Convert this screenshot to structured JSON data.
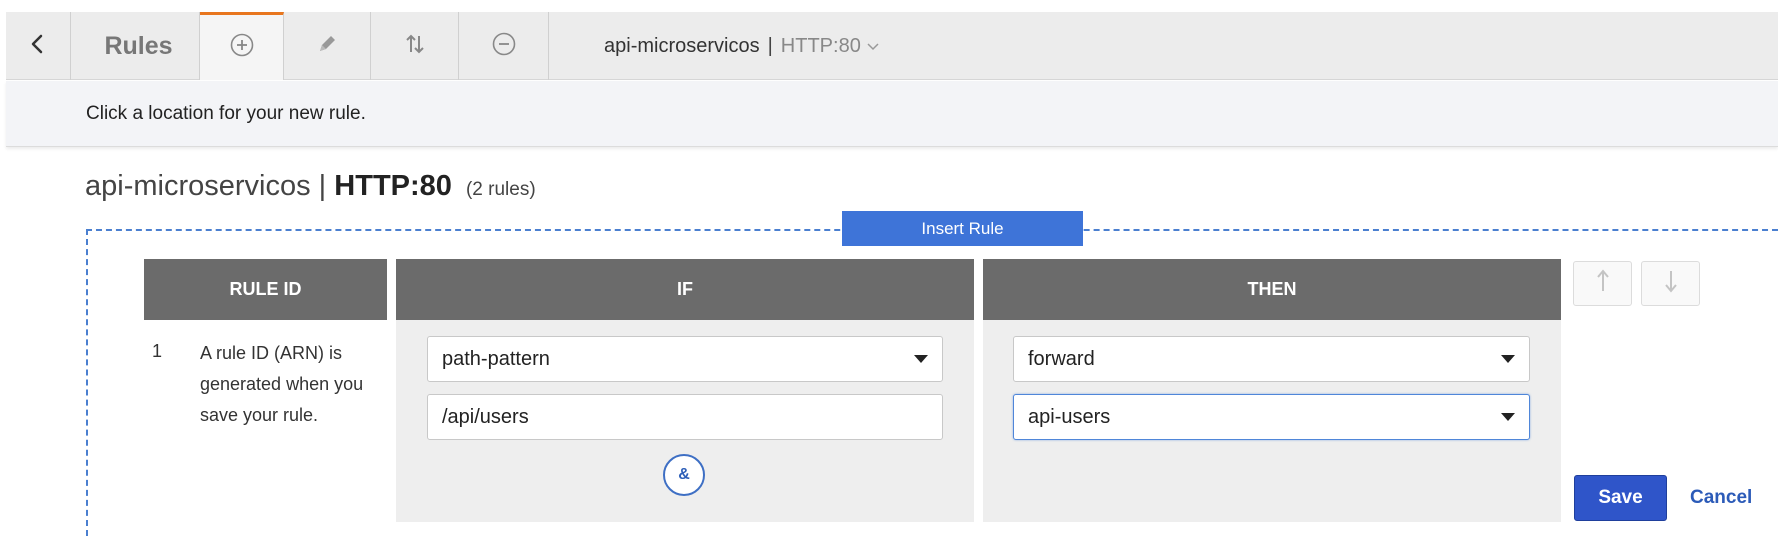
{
  "toolbar": {
    "back_icon": "chevron-left-icon",
    "title": "Rules",
    "buttons": [
      {
        "name": "add-rule-button",
        "icon": "plus-circle-icon",
        "active": true
      },
      {
        "name": "edit-rule-button",
        "icon": "pencil-icon",
        "active": false
      },
      {
        "name": "reorder-rules-button",
        "icon": "sort-arrows-icon",
        "active": false
      },
      {
        "name": "delete-rule-button",
        "icon": "minus-circle-icon",
        "active": false
      }
    ],
    "load_balancer": "api-microservicos",
    "separator": "|",
    "listener": "HTTP:80",
    "dropdown_icon": "chevron-down-icon",
    "accent_color": "#e8761e"
  },
  "hint": "Click a location for your new rule.",
  "heading": {
    "load_balancer": "api-microservicos",
    "separator": "|",
    "listener": "HTTP:80",
    "rule_count": "(2 rules)"
  },
  "insert_rule": {
    "label": "Insert Rule",
    "color": "#3e74d8"
  },
  "table": {
    "headers": {
      "rule_id": "RULE ID",
      "if": "IF",
      "then": "THEN"
    },
    "row": {
      "number": "1",
      "description": "A rule ID (ARN) is generated when you save your rule.",
      "condition": {
        "type": "path-pattern",
        "value": "/api/users",
        "and_label": "&"
      },
      "action": {
        "type": "forward",
        "target_group": "api-users"
      }
    }
  },
  "actions": {
    "move_up_icon": "arrow-up-icon",
    "move_down_icon": "arrow-down-icon",
    "save": "Save",
    "cancel": "Cancel",
    "save_color": "#2f55c9"
  }
}
